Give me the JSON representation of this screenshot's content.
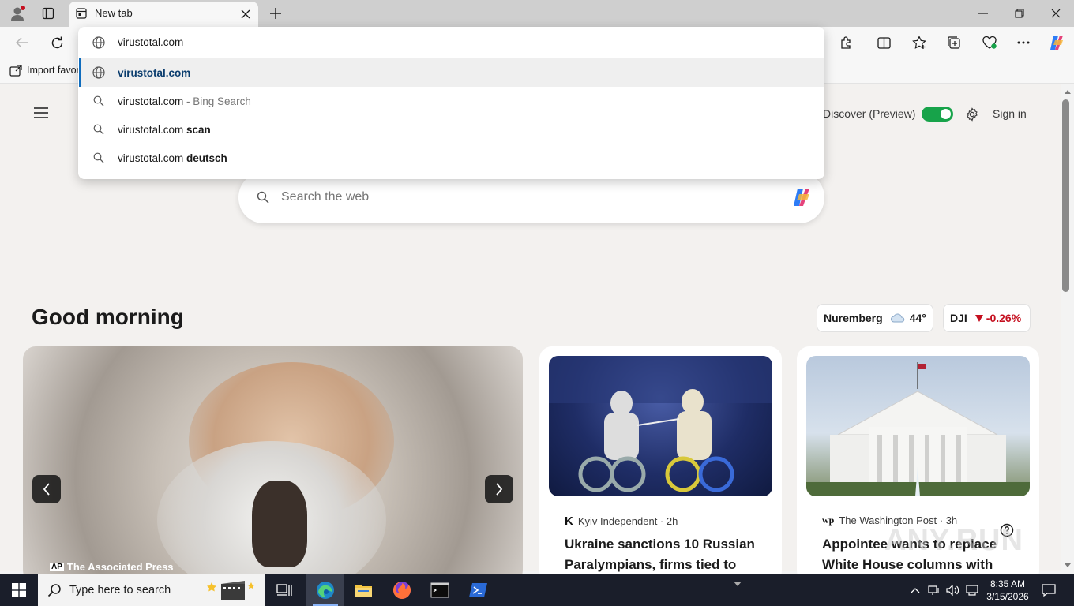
{
  "window": {
    "tab_title": "New tab",
    "favorites_label": "Import favorites"
  },
  "address_bar": {
    "typed_text": "virustotal.com"
  },
  "suggestions": [
    {
      "text": "virustotal.com",
      "suffix": "",
      "bold_suffix": "",
      "icon": "globe-icon",
      "selected": true
    },
    {
      "text": "virustotal.com",
      "suffix": " - Bing Search",
      "bold_suffix": "",
      "icon": "search-icon",
      "selected": false
    },
    {
      "text": "virustotal.com ",
      "suffix": "",
      "bold_suffix": "scan",
      "icon": "search-icon",
      "selected": false
    },
    {
      "text": "virustotal.com ",
      "suffix": "",
      "bold_suffix": "deutsch",
      "icon": "search-icon",
      "selected": false
    }
  ],
  "page": {
    "discover_label": "Discover (Preview)",
    "discover_enabled": true,
    "sign_in_label": "Sign in",
    "search_placeholder": "Search the web",
    "greeting": "Good morning",
    "weather": {
      "city": "Nuremberg",
      "temp": "44°"
    },
    "stock": {
      "symbol": "DJI",
      "change": "-0.26%",
      "direction": "down"
    },
    "hero": {
      "source": "The Associated Press",
      "source_logo": "AP"
    },
    "cards": [
      {
        "source": "Kyiv Independent · 2h",
        "headline": "Ukraine sanctions 10 Russian Paralympians, firms tied to"
      },
      {
        "source": "The Washington Post · 3h",
        "headline": "Appointee wants to replace White House columns with"
      }
    ]
  },
  "taskbar": {
    "search_placeholder": "Type here to search",
    "time": "8:35 AM",
    "date": "3/15/2026"
  },
  "watermark": "ANY.RUN",
  "colors": {
    "accent": "#0f6cbd",
    "toggle_on": "#17a34a",
    "negative": "#c50f1f",
    "taskbar": "#1a1e2a"
  }
}
